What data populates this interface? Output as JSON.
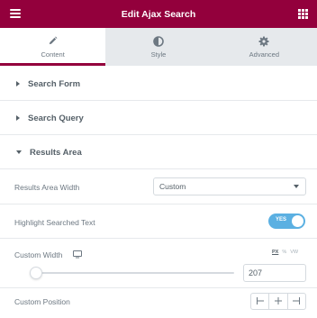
{
  "header": {
    "title": "Edit Ajax Search",
    "brand_color": "#93003c"
  },
  "tabs": [
    {
      "label": "Content",
      "icon": "pencil-icon",
      "active": true
    },
    {
      "label": "Style",
      "icon": "half-circle-icon",
      "active": false
    },
    {
      "label": "Advanced",
      "icon": "gear-icon",
      "active": false
    }
  ],
  "sections": [
    {
      "title": "Search Form",
      "expanded": false
    },
    {
      "title": "Search Query",
      "expanded": false
    },
    {
      "title": "Results Area",
      "expanded": true
    }
  ],
  "controls": {
    "results_area_width": {
      "label": "Results Area Width",
      "value": "Custom"
    },
    "highlight": {
      "label": "Highlight Searched Text",
      "enabled": true,
      "toggle_text": "YES",
      "toggle_color": "#5bb0e2"
    },
    "custom_width": {
      "label": "Custom Width",
      "device_icon": "desktop-icon",
      "units": [
        "PX",
        "%",
        "VW"
      ],
      "active_unit": "PX",
      "value": "207",
      "slider_fraction": 0.02
    },
    "custom_position": {
      "label": "Custom Position",
      "options": [
        "align-left-icon",
        "align-center-icon",
        "align-right-icon"
      ]
    }
  }
}
